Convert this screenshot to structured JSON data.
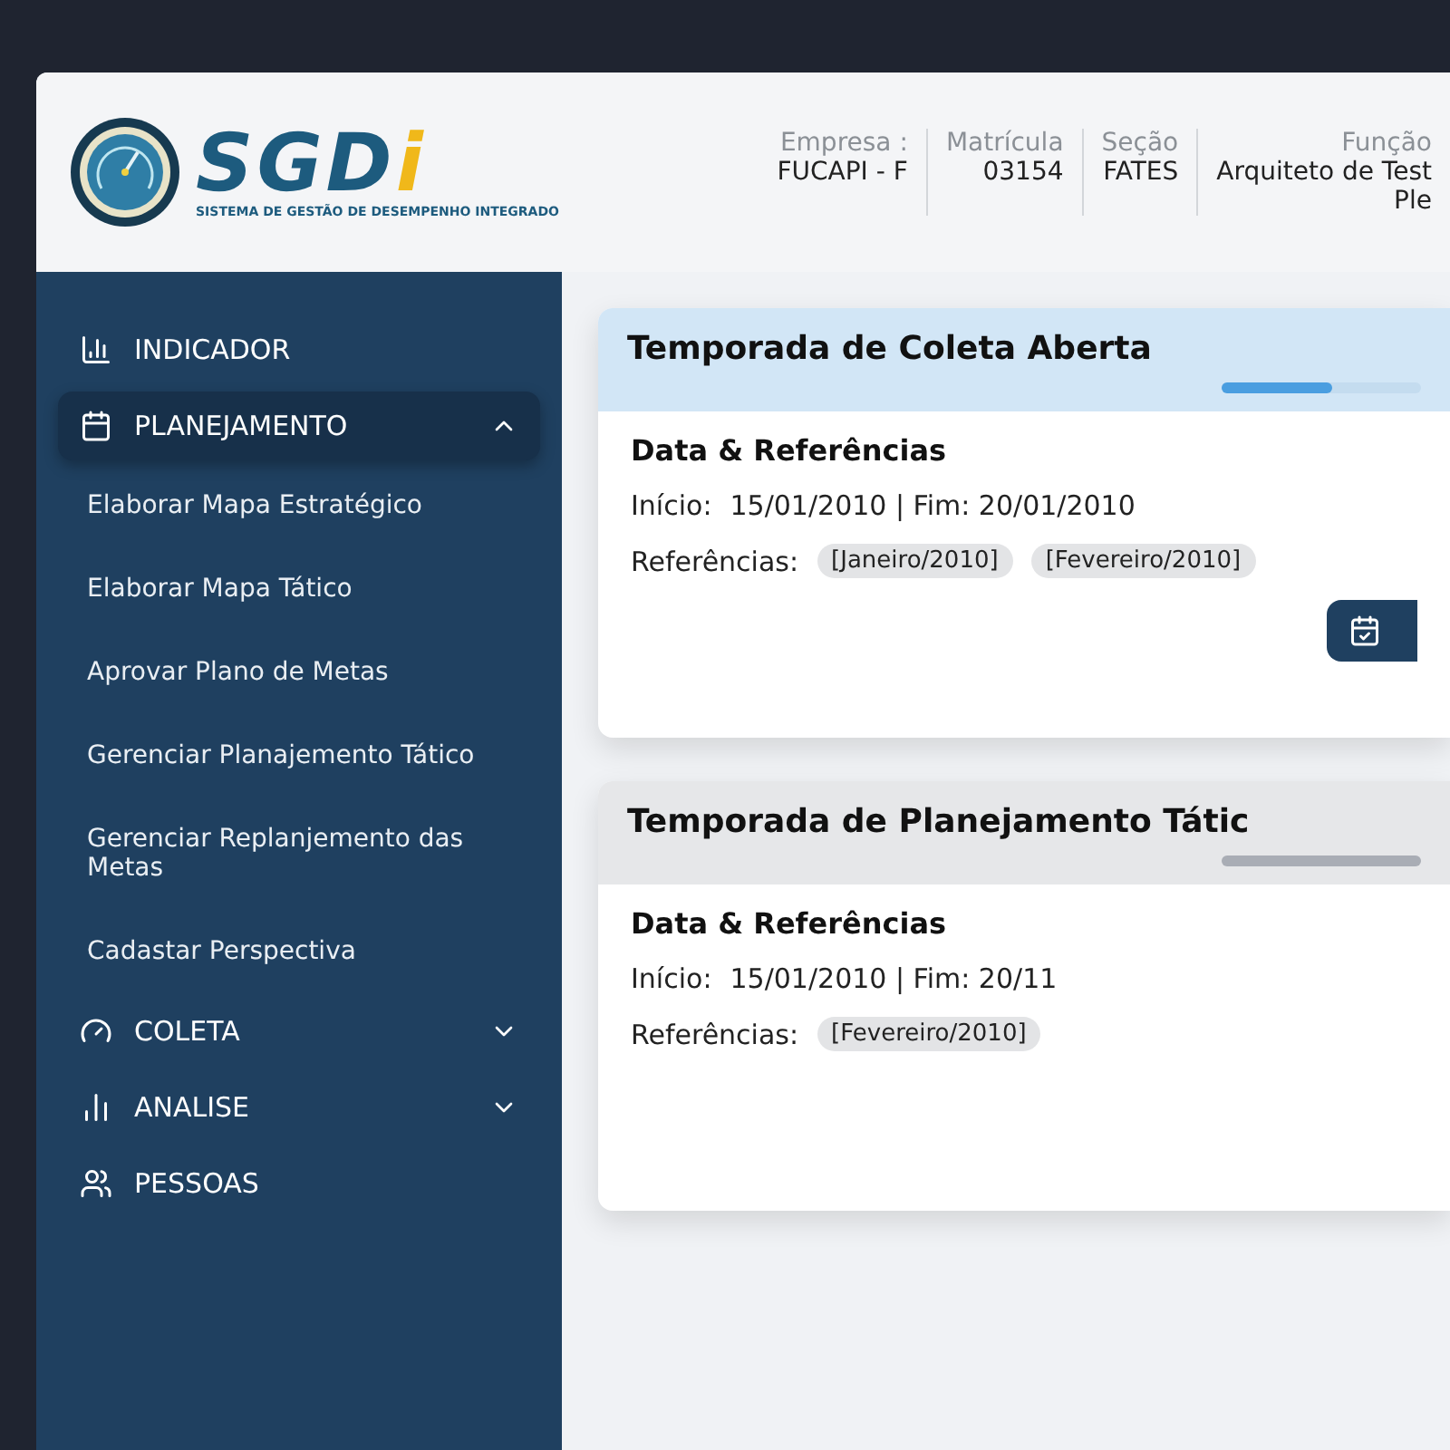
{
  "logo": {
    "mark": "SGD",
    "accent": "i",
    "subtitle": "SISTEMA DE GESTÃO DE DESEMPENHO INTEGRADO"
  },
  "header_info": [
    {
      "label": "Empresa :",
      "value": "FUCAPI - F"
    },
    {
      "label": "Matrícula",
      "value": "03154"
    },
    {
      "label": "Seção",
      "value": "FATES"
    },
    {
      "label": "Função",
      "value": "Arquiteto de Test",
      "value_2": "Ple"
    }
  ],
  "sidebar": {
    "items": [
      {
        "label": "INDICADOR",
        "selected": false
      },
      {
        "label": "PLANEJAMENTO",
        "selected": true,
        "expanded": true,
        "children": [
          {
            "label": "Elaborar Mapa Estratégico"
          },
          {
            "label": "Elaborar Mapa Tático"
          },
          {
            "label": "Aprovar Plano de Metas"
          },
          {
            "label": "Gerenciar Planajemento Tático"
          },
          {
            "label": "Gerenciar Replanjemento das Metas"
          },
          {
            "label": "Cadastar Perspectiva"
          }
        ]
      },
      {
        "label": "COLETA",
        "selected": false,
        "expanded": false
      },
      {
        "label": "ANALISE",
        "selected": false,
        "expanded": false
      },
      {
        "label": "PESSOAS",
        "selected": false
      }
    ]
  },
  "cards": [
    {
      "title": "Temporada de Coleta Aberta",
      "kind": "open",
      "level": 0.55,
      "section": "Data & Referências",
      "start_label": "Início:",
      "dates": "15/01/2010 | Fim: 20/01/2010",
      "refs_label": "Referências:",
      "refs": [
        "[Janeiro/2010]",
        "[Fevereiro/2010]"
      ],
      "has_action": true
    },
    {
      "title": "Temporada de Planejamento Tátic",
      "kind": "closed",
      "section": "Data & Referências",
      "start_label": "Início:",
      "dates": "15/01/2010 | Fim: 20/11",
      "refs_label": "Referências:",
      "refs": [
        "[Fevereiro/2010]"
      ],
      "has_action": false
    }
  ]
}
